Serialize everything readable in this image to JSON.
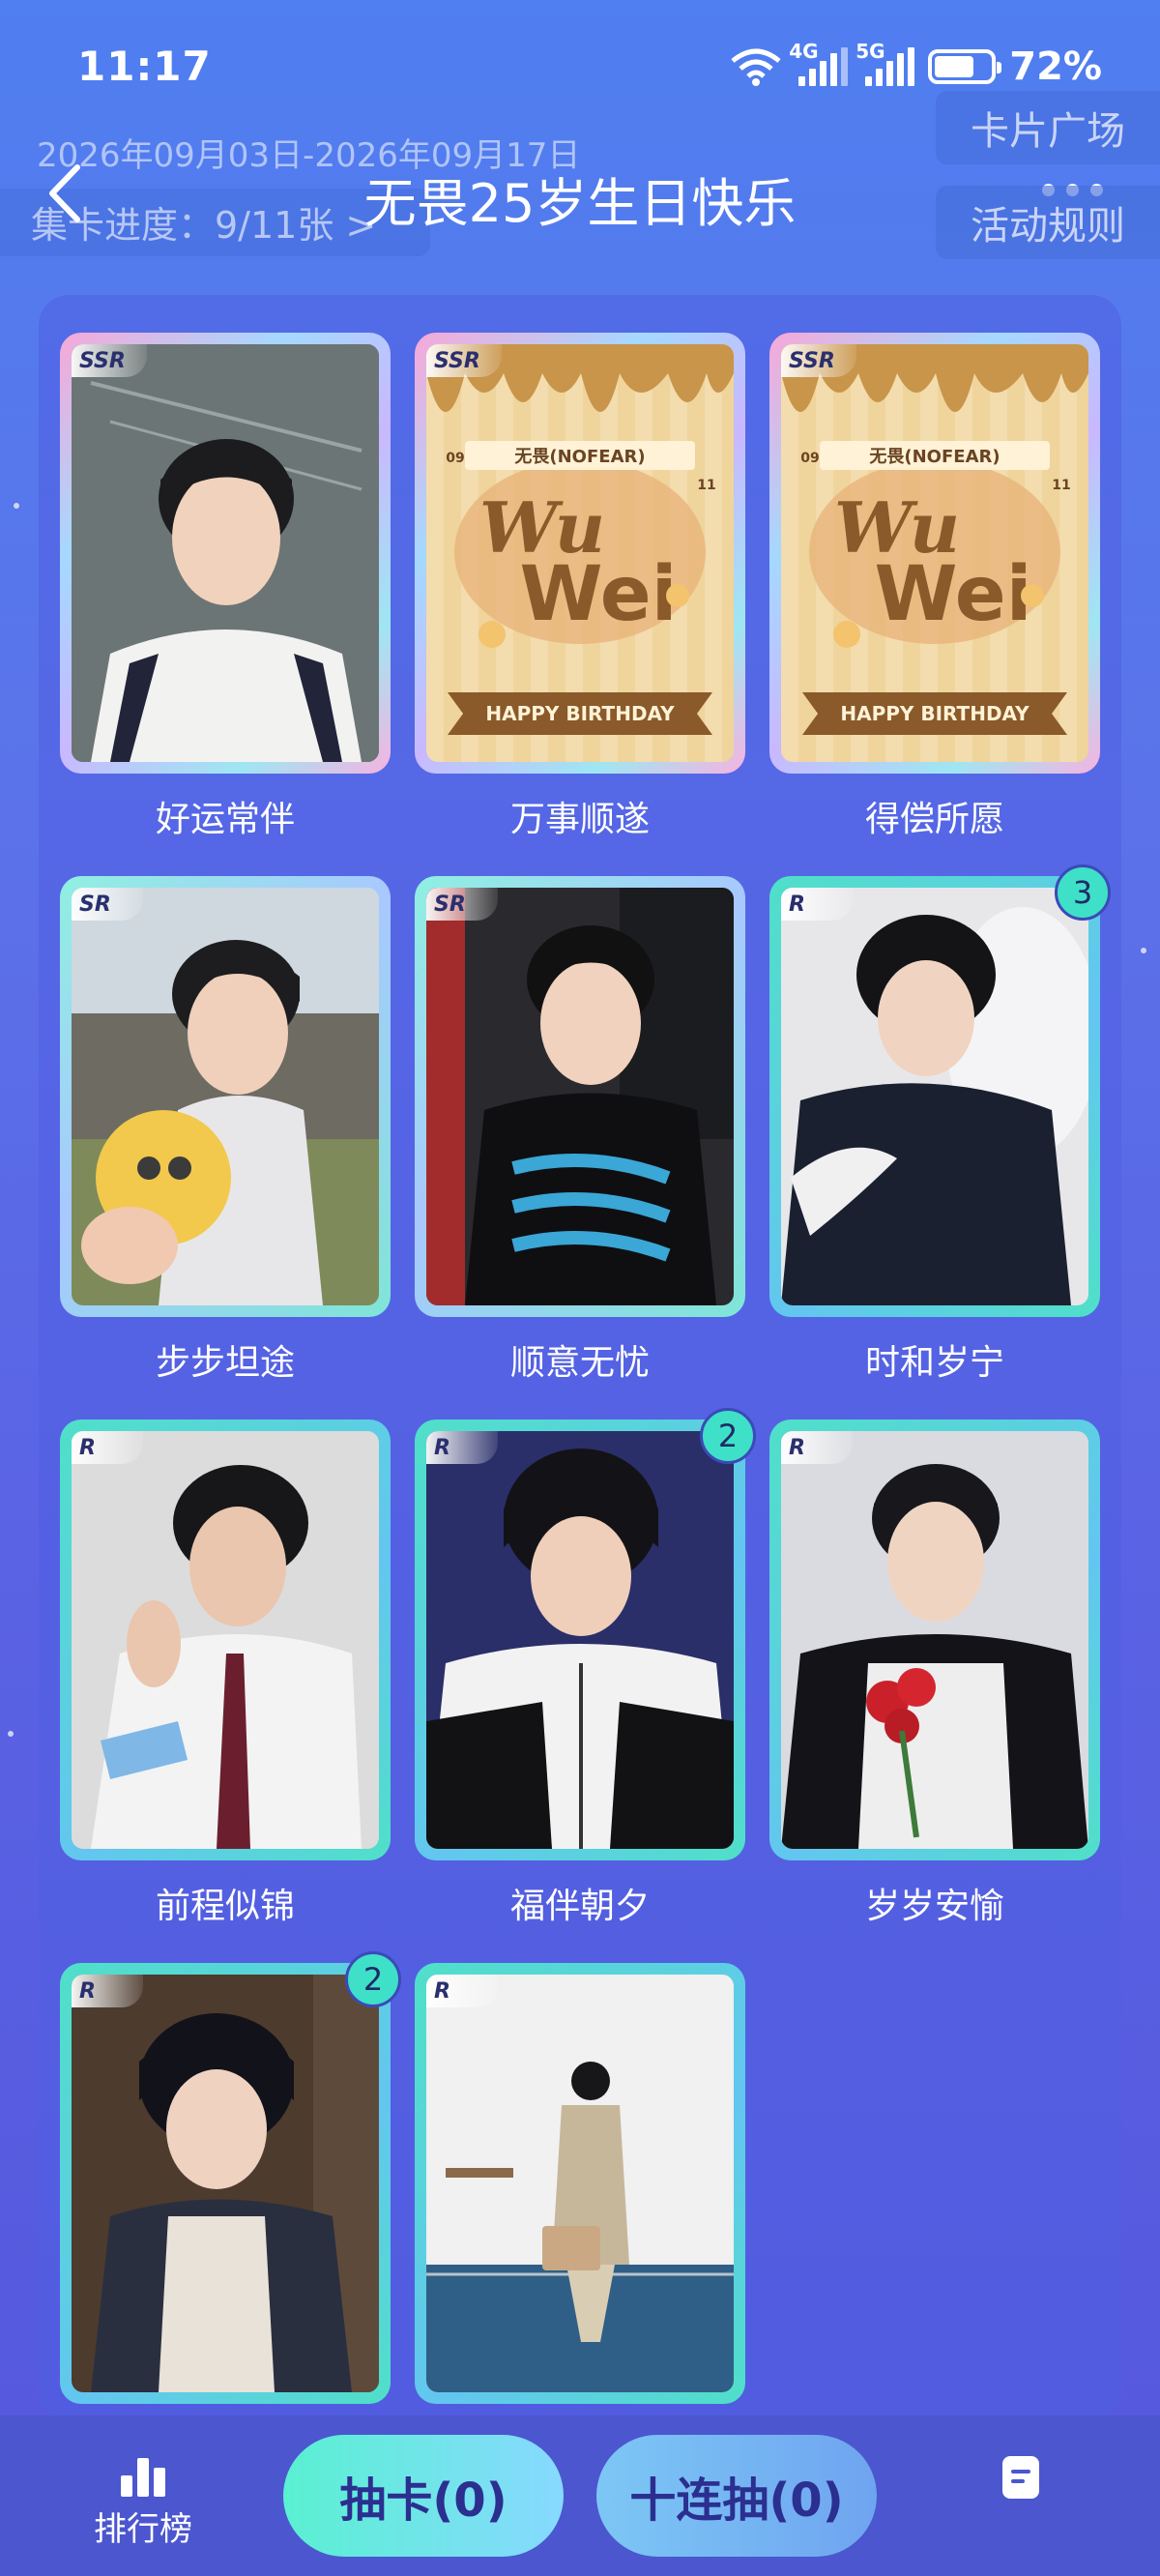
{
  "status": {
    "time": "11:17",
    "net1": "4G",
    "net2": "5G",
    "battery": "72%",
    "battery_level": 0.72
  },
  "header": {
    "date_range": "2026年09月03日-2026年09月17日",
    "title": "无畏25岁生日快乐",
    "progress": "集卡进度：9/11张 >",
    "plaza": "卡片广场",
    "rules": "活动规则"
  },
  "colors": {
    "accent_teal": "#3ee0c7",
    "bg_blue": "#5a63e4"
  },
  "cards": [
    {
      "name": "好运常伴",
      "rarity": "SSR",
      "count": ""
    },
    {
      "name": "万事顺遂",
      "rarity": "SSR",
      "count": ""
    },
    {
      "name": "得偿所愿",
      "rarity": "SSR",
      "count": ""
    },
    {
      "name": "步步坦途",
      "rarity": "SR",
      "count": ""
    },
    {
      "name": "顺意无忧",
      "rarity": "SR",
      "count": ""
    },
    {
      "name": "时和岁宁",
      "rarity": "R",
      "count": "3"
    },
    {
      "name": "前程似锦",
      "rarity": "R",
      "count": ""
    },
    {
      "name": "福伴朝夕",
      "rarity": "R",
      "count": "2"
    },
    {
      "name": "岁岁安愉",
      "rarity": "R",
      "count": ""
    },
    {
      "name": "",
      "rarity": "R",
      "count": "2"
    },
    {
      "name": "",
      "rarity": "R",
      "count": ""
    }
  ],
  "bday_art": {
    "label": "无畏(NOFEAR)",
    "big1": "Wu",
    "big2": "Wei",
    "banner": "HAPPY BIRTHDAY",
    "left_num": "09",
    "right_num": "11"
  },
  "bottom": {
    "rank_label": "排行榜",
    "draw_one": "抽卡(0)",
    "draw_ten": "十连抽(0)"
  }
}
